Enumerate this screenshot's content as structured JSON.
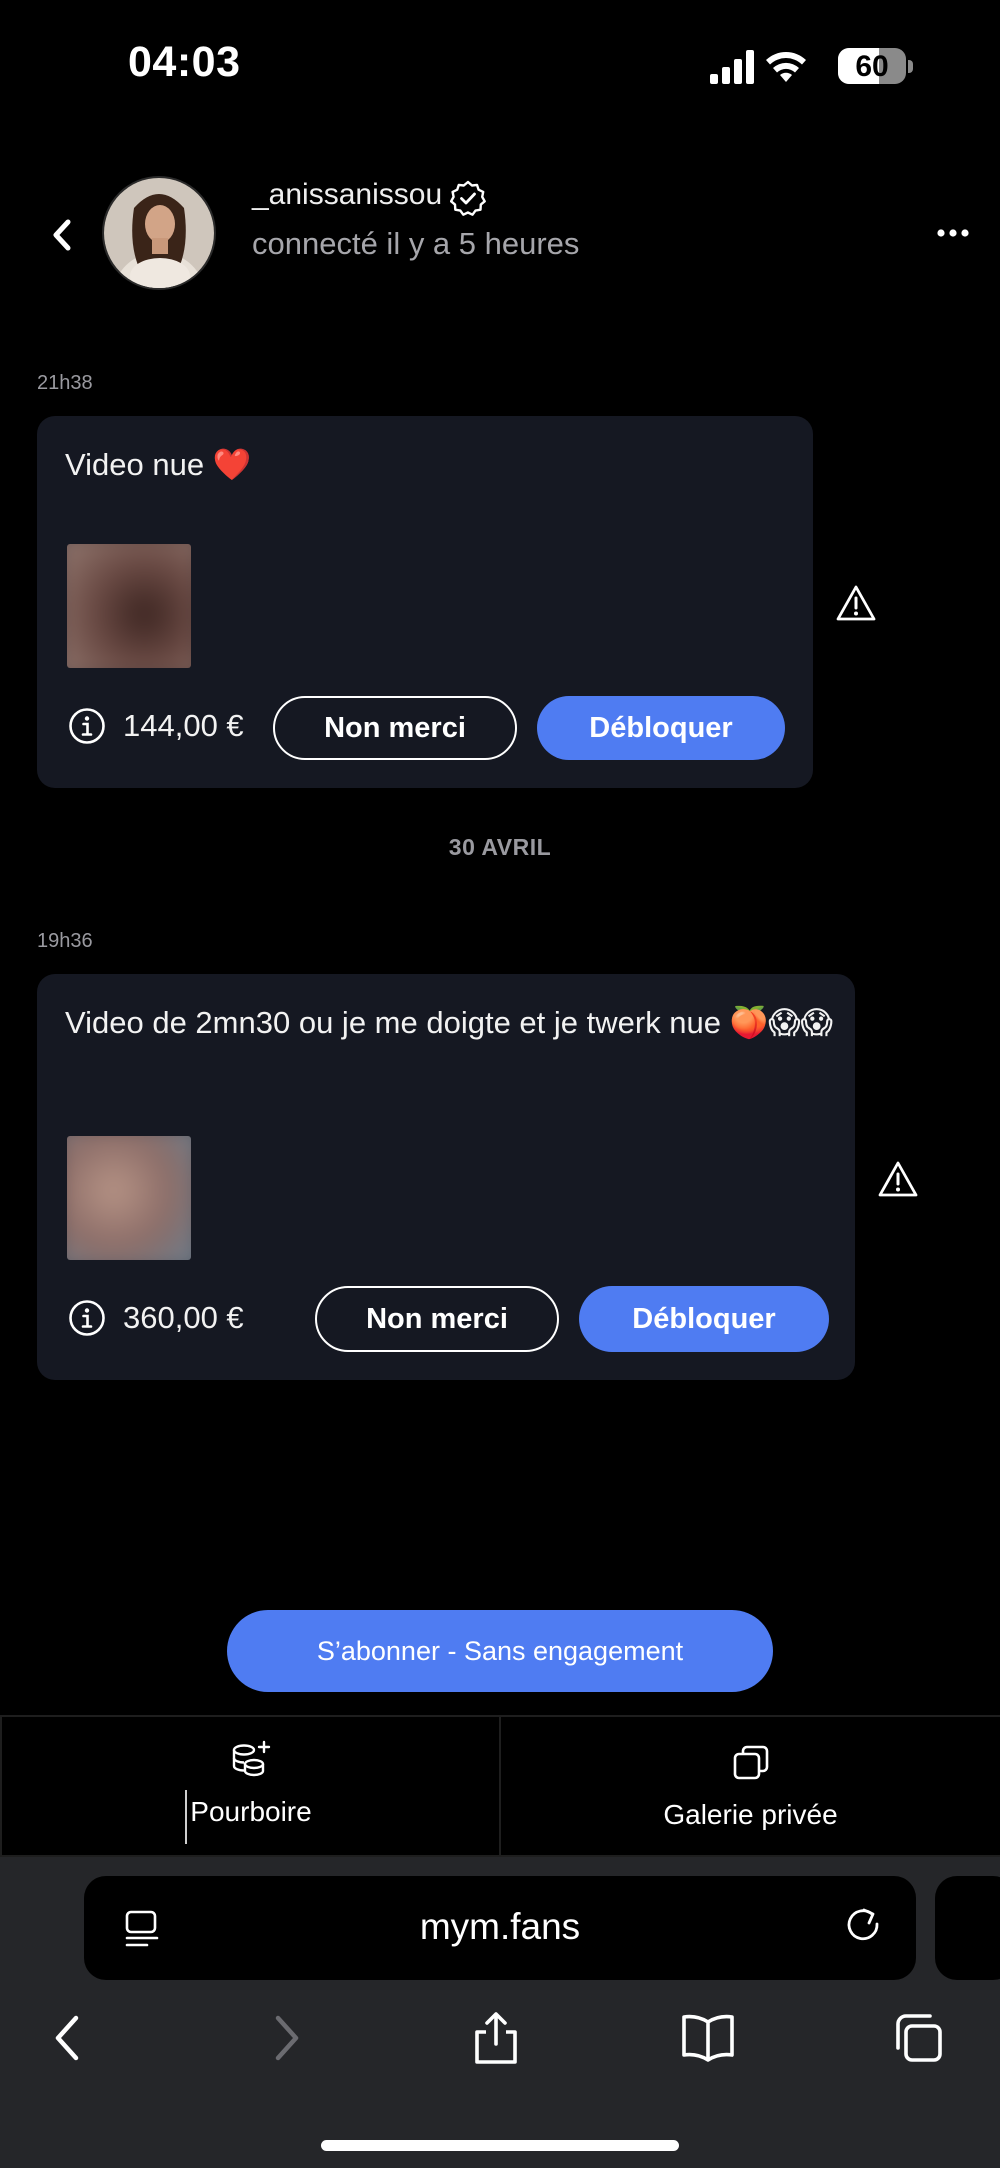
{
  "status_bar": {
    "time": "04:03",
    "battery": "60",
    "battery_level": 0.6
  },
  "header": {
    "back_icon": "chevron-left-icon",
    "username": "_anissanissou",
    "verified_icon": "verified-badge-icon",
    "presence": "connecté il y a 5 heures",
    "more_icon": "ellipsis-icon"
  },
  "messages": [
    {
      "time": "21h38",
      "text": "Video nue ❤️",
      "price": "144,00 €",
      "decline_label": "Non merci",
      "unlock_label": "Débloquer"
    },
    {
      "time": "19h36",
      "text": "Video de 2mn30 ou je me doigte et je twerk nue 🍑😱😱",
      "price": "360,00 €",
      "decline_label": "Non merci",
      "unlock_label": "Débloquer"
    }
  ],
  "date_separator": "30 AVRIL",
  "subscribe_label": "S’abonner - Sans engagement",
  "actions": {
    "tip_label": "Pourboire",
    "gallery_label": "Galerie privée"
  },
  "browser": {
    "url": "mym.fans"
  },
  "colors": {
    "accent": "#4f7cf2",
    "bubble": "#151822",
    "background": "#000000",
    "browser_chrome": "#252629"
  }
}
